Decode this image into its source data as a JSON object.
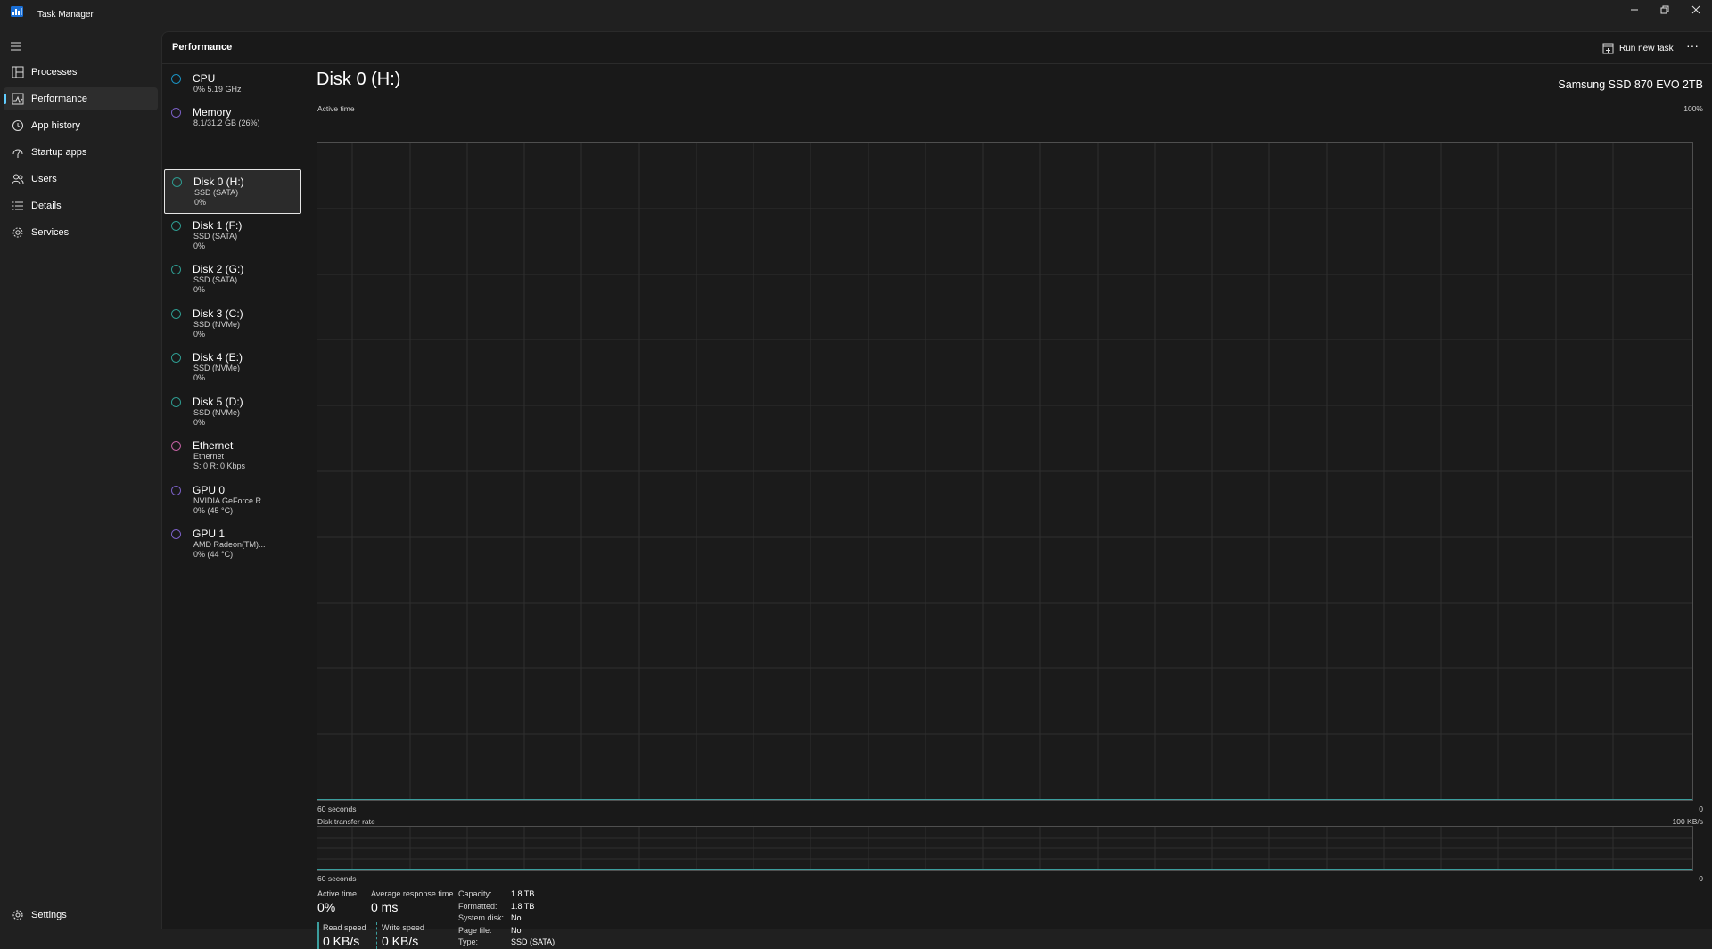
{
  "window": {
    "title": "Task Manager",
    "accent": "#60cdff"
  },
  "nav": {
    "items": [
      {
        "label": "Processes",
        "icon": "processes-icon"
      },
      {
        "label": "Performance",
        "icon": "performance-icon",
        "active": true
      },
      {
        "label": "App history",
        "icon": "app-history-icon"
      },
      {
        "label": "Startup apps",
        "icon": "startup-apps-icon"
      },
      {
        "label": "Users",
        "icon": "users-icon"
      },
      {
        "label": "Details",
        "icon": "details-icon"
      },
      {
        "label": "Services",
        "icon": "services-icon"
      }
    ],
    "settings": {
      "label": "Settings",
      "icon": "settings-icon"
    }
  },
  "header": {
    "title": "Performance",
    "run_new_task": "Run new task",
    "more": "···"
  },
  "resources": [
    {
      "title": "CPU",
      "line1": "0% 5.19 GHz",
      "line2": "",
      "color": "#1a8fbf"
    },
    {
      "title": "Memory",
      "line1": "8.1/31.2 GB (26%)",
      "line2": "",
      "color": "#7a5fc4"
    },
    {
      "title": "Disk 0 (H:)",
      "line1": "SSD (SATA)",
      "line2": "0%",
      "color": "#2e9a8f",
      "selected": true
    },
    {
      "title": "Disk 1 (F:)",
      "line1": "SSD (SATA)",
      "line2": "0%",
      "color": "#2e9a8f"
    },
    {
      "title": "Disk 2 (G:)",
      "line1": "SSD (SATA)",
      "line2": "0%",
      "color": "#2e9a8f"
    },
    {
      "title": "Disk 3 (C:)",
      "line1": "SSD (NVMe)",
      "line2": "0%",
      "color": "#2e9a8f"
    },
    {
      "title": "Disk 4 (E:)",
      "line1": "SSD (NVMe)",
      "line2": "0%",
      "color": "#2e9a8f"
    },
    {
      "title": "Disk 5 (D:)",
      "line1": "SSD (NVMe)",
      "line2": "0%",
      "color": "#2e9a8f"
    },
    {
      "title": "Ethernet",
      "line1": "Ethernet",
      "line2": "S: 0 R: 0 Kbps",
      "color": "#c060a0"
    },
    {
      "title": "GPU 0",
      "line1": "NVIDIA GeForce R...",
      "line2": "0% (45 °C)",
      "color": "#7a5fc4"
    },
    {
      "title": "GPU 1",
      "line1": "AMD Radeon(TM)...",
      "line2": "0% (44 °C)",
      "color": "#7a5fc4"
    }
  ],
  "detail": {
    "title": "Disk 0 (H:)",
    "model": "Samsung SSD 870 EVO 2TB",
    "graph1": {
      "label": "Active time",
      "max": "100%",
      "time_label": "60 seconds",
      "min": "0"
    },
    "graph2": {
      "label": "Disk transfer rate",
      "max": "100 KB/s",
      "time_label": "60 seconds",
      "min": "0"
    },
    "stats": {
      "active_time_label": "Active time",
      "active_time_value": "0%",
      "avg_response_label": "Average response time",
      "avg_response_value": "0 ms",
      "read_speed_label": "Read speed",
      "read_speed_value": "0 KB/s",
      "write_speed_label": "Write speed",
      "write_speed_value": "0 KB/s"
    },
    "properties": [
      {
        "key": "Capacity:",
        "value": "1.8 TB"
      },
      {
        "key": "Formatted:",
        "value": "1.8 TB"
      },
      {
        "key": "System disk:",
        "value": "No"
      },
      {
        "key": "Page file:",
        "value": "No"
      },
      {
        "key": "Type:",
        "value": "SSD (SATA)"
      }
    ],
    "graph_color": "#3b9d9d"
  }
}
